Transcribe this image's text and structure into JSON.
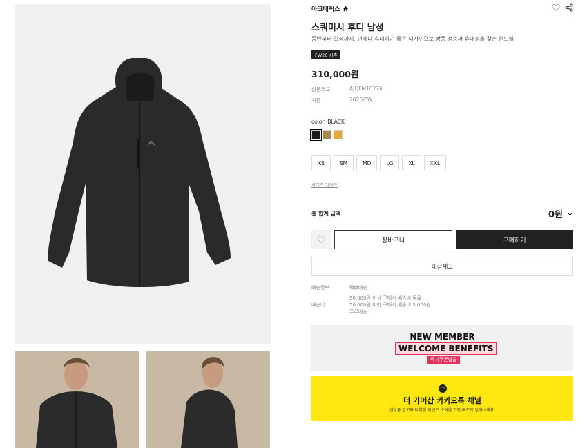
{
  "brand": {
    "name": "아크테릭스"
  },
  "product": {
    "title": "스쿼미시 후디 남성",
    "description": "등반부터 일상까지, 언제나 휴대하기 좋은 디자인으로 방풍 성능과 휴대성을 갖춘 윈드쉘",
    "season_tag": "FW26 시즌",
    "price": "310,000원",
    "meta": [
      {
        "key": "상품코드",
        "value": "AJQFM10276"
      },
      {
        "key": "시즌",
        "value": "2026/FW"
      }
    ],
    "color_label": "color: BLACK",
    "swatches": [
      "#1a1a1a",
      "#a88a4a",
      "#e8a93a"
    ],
    "sizes": [
      "XS",
      "SM",
      "MD",
      "LG",
      "XL",
      "XXL"
    ],
    "size_guide": "사이즈 가이드"
  },
  "total": {
    "label": "총 합계 금액",
    "value": "0원"
  },
  "actions": {
    "cart": "장바구니",
    "buy": "구매하기",
    "stock": "매장재고"
  },
  "shipping": {
    "info_key": "배송정보",
    "info_value": "택배배송",
    "fee_key": "배송비",
    "fee_lines": [
      "50,000원 이상 구매시 배송비 무료",
      "50,000원 미만 구매시 배송비 3,000원",
      "무료배송"
    ]
  },
  "banner_member": {
    "line1": "NEW MEMBER",
    "line2": "WELCOME BENEFITS",
    "line3": "즉시쿠폰발급"
  },
  "banner_kakao": {
    "badge": "ch",
    "title": "더 기어샵 카카오톡 채널",
    "subtitle": "신상품 입고와 다양한 이벤트 소식을 가장 빠르게 받아보세요."
  },
  "colors": {
    "accent_dark": "#222222",
    "kakao_yellow": "#ffe812",
    "promo_pink": "#e4335a"
  }
}
